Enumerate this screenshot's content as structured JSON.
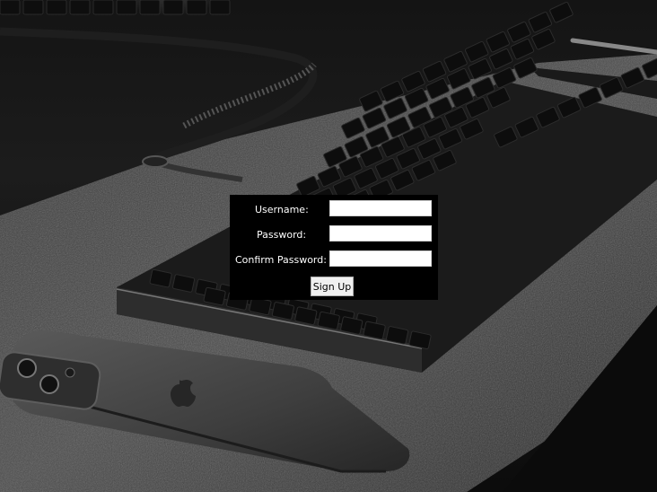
{
  "signup_form": {
    "username_label": "Username:",
    "password_label": "Password:",
    "confirm_password_label": "Confirm Password:",
    "username_value": "",
    "password_value": "",
    "confirm_password_value": "",
    "signup_button_label": "Sign Up"
  }
}
